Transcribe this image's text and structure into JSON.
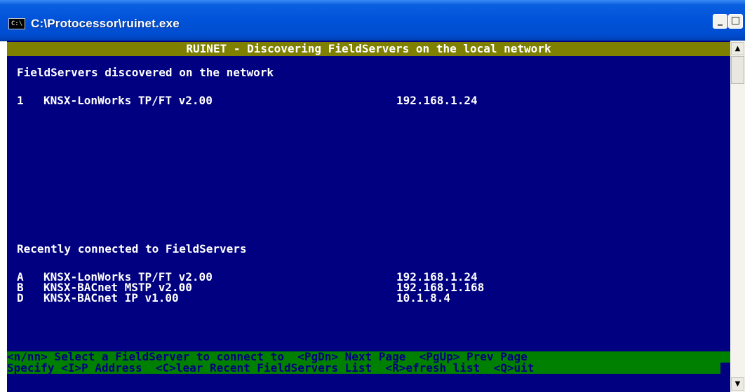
{
  "window": {
    "icon_text": "C:\\",
    "title": "C:\\Protocessor\\ruinet.exe",
    "minimize": "_",
    "maximize": "□",
    "close": "×"
  },
  "console": {
    "header": "RUINET - Discovering FieldServers on the local network",
    "discovered_heading": "FieldServers discovered on the network",
    "discovered": [
      {
        "key": "1",
        "name": "KNSX-LonWorks TP/FT v2.00",
        "ip": "192.168.1.24"
      }
    ],
    "recent_heading": "Recently connected to FieldServers",
    "recent": [
      {
        "key": "A",
        "name": "KNSX-LonWorks TP/FT v2.00",
        "ip": "192.168.1.24"
      },
      {
        "key": "B",
        "name": "KNSX-BACnet MSTP v2.00",
        "ip": "192.168.1.168"
      },
      {
        "key": "D",
        "name": "KNSX-BACnet IP v1.00",
        "ip": "10.1.8.4"
      }
    ],
    "footer_line1": "<n/nn> Select a FieldServer to connect to  <PgDn> Next Page  <PgUp> Prev Page",
    "footer_line2": "Specify <I>P Address  <C>lear Recent FieldServers List  <R>efresh list  <Q>uit"
  },
  "scrollbar": {
    "up_arrow": "▲",
    "down_arrow": "▼"
  },
  "colors": {
    "console_bg": "#000080",
    "header_bg": "#808000",
    "footer_bg": "#008000",
    "titlebar": "#0052d8"
  }
}
